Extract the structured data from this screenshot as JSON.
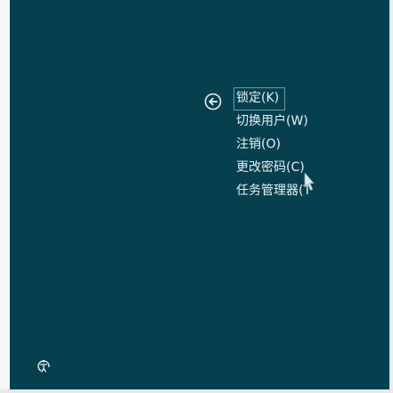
{
  "menu": {
    "items": [
      {
        "label": "锁定(K)"
      },
      {
        "label": "切换用户(W)"
      },
      {
        "label": "注销(O)"
      },
      {
        "label": "更改密码(C)"
      },
      {
        "label": "任务管理器(T"
      }
    ]
  },
  "icons": {
    "back": "arrow-left-circle-icon",
    "ease_of_access": "ease-of-access-icon",
    "cursor": "mouse-pointer-icon"
  },
  "colors": {
    "background": "#06404f",
    "text": "#e8f0f2",
    "selection_border": "#6d9aa6"
  }
}
